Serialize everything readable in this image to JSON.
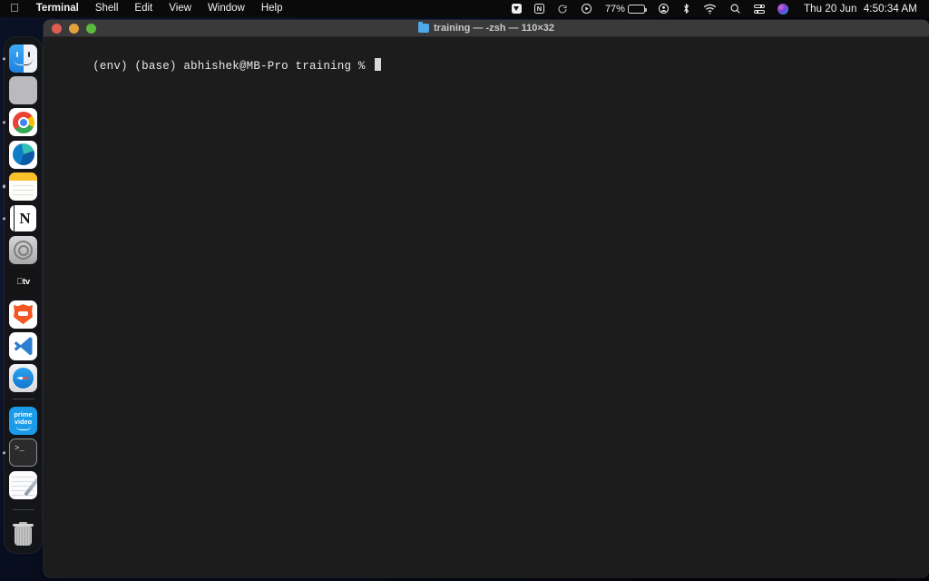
{
  "menubar": {
    "apple_logo": "",
    "app_name": "Terminal",
    "items": [
      {
        "label": "Shell"
      },
      {
        "label": "Edit"
      },
      {
        "label": "View"
      },
      {
        "label": "Window"
      },
      {
        "label": "Help"
      }
    ],
    "status_icons": [
      {
        "name": "dropbox-icon",
        "glyph": ""
      },
      {
        "name": "notion-menubar-icon",
        "glyph": "N"
      },
      {
        "name": "sync-icon",
        "glyph": "↻"
      },
      {
        "name": "play-circle-icon",
        "glyph": "▶"
      }
    ],
    "battery": {
      "percent_label": "77%",
      "level": 77
    },
    "account_icon": "account-circle-icon",
    "bluetooth_icon": "bluetooth-icon",
    "wifi_icon": "wifi-icon",
    "search_icon": "search-icon",
    "control_center_icon": "control-center-icon",
    "siri_icon": "siri-icon",
    "date": "Thu 20 Jun",
    "time": "4:50:34 AM"
  },
  "dock": {
    "items": [
      {
        "name": "finder",
        "label": "Finder",
        "running": true
      },
      {
        "name": "launchpad",
        "label": "Launchpad",
        "running": false
      },
      {
        "name": "chrome",
        "label": "Google Chrome",
        "running": true
      },
      {
        "name": "edge",
        "label": "Microsoft Edge",
        "running": false
      },
      {
        "name": "notes",
        "label": "Notes",
        "running": true
      },
      {
        "name": "notion",
        "label": "Notion",
        "running": true
      },
      {
        "name": "disk-utility",
        "label": "Disk Utility",
        "running": false
      },
      {
        "name": "apple-tv",
        "label": "Apple TV",
        "running": false
      },
      {
        "name": "brave",
        "label": "Brave Browser",
        "running": false
      },
      {
        "name": "vscode",
        "label": "Visual Studio Code",
        "running": false
      },
      {
        "name": "safari",
        "label": "Safari",
        "running": false
      },
      {
        "name": "prime-video",
        "label": "Prime Video",
        "running": false
      },
      {
        "name": "terminal",
        "label": "Terminal",
        "running": true
      },
      {
        "name": "textedit",
        "label": "TextEdit",
        "running": false
      }
    ],
    "trash": {
      "name": "trash",
      "label": "Trash"
    },
    "apple_tv_label": "tv",
    "notion_letter": "N",
    "prime_line1": "prime",
    "prime_line2": "video",
    "terminal_glyph": ">_"
  },
  "window": {
    "title": "training — -zsh — 110×32",
    "folder_icon": "folder-icon",
    "traffic_lights": {
      "close": "close-button",
      "minimize": "minimize-button",
      "zoom": "zoom-button"
    }
  },
  "terminal": {
    "prompt_line": "(env) (base) abhishek@MB-Pro training % ",
    "env_prefix": "(env)",
    "conda_prefix": "(base)",
    "user_host": "abhishek@MB-Pro",
    "cwd": "training",
    "symbol": "%",
    "command": ""
  },
  "colors": {
    "menubar_bg": "#0a0a0a",
    "terminal_bg": "#1c1c1c",
    "titlebar_bg": "#3a3a3a",
    "dock_bg": "rgba(22,22,24,.92)",
    "text": "#e9e9e9",
    "accent_blue": "#4fa8e8"
  }
}
